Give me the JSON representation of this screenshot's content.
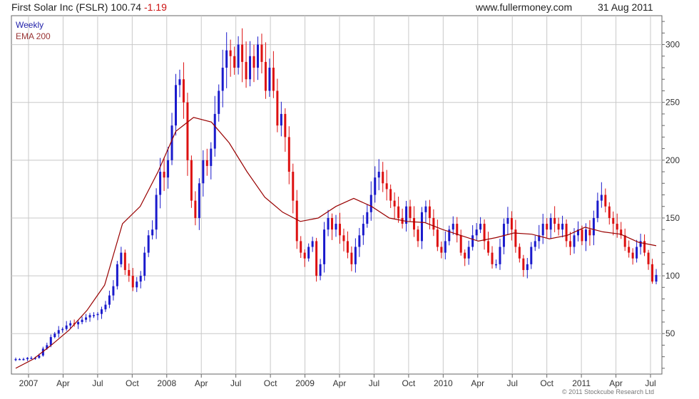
{
  "header": {
    "title_main": "First Solar Inc (FSLR) 100.74",
    "title_change": "-1.19",
    "site": "www.fullermoney.com",
    "date": "31 Aug 2011"
  },
  "legend": {
    "series1": "Weekly",
    "series2": "EMA 200"
  },
  "footer": {
    "copyright": "© 2011 Stockcube Research Ltd"
  },
  "colors": {
    "up": "#1a1acc",
    "down": "#dd1111",
    "ema": "#990000",
    "grid": "#c8c8c8"
  },
  "chart_data": {
    "type": "candlestick",
    "title": "First Solar Inc (FSLR) 100.74 -1.19",
    "ylim": [
      15,
      325
    ],
    "y_ticks": [
      50,
      100,
      150,
      200,
      250,
      300
    ],
    "x_tick_labels": [
      "2007",
      "Apr",
      "Jul",
      "Oct",
      "2008",
      "Apr",
      "Jul",
      "Oct",
      "2009",
      "Apr",
      "Jul",
      "Oct",
      "2010",
      "Apr",
      "Jul",
      "Oct",
      "2011",
      "Apr",
      "Jul"
    ],
    "series": [
      {
        "name": "Weekly",
        "kind": "close",
        "x_range": [
          "2007-01",
          "2011-08"
        ],
        "values": [
          28,
          28,
          28,
          29,
          29,
          29,
          31,
          37,
          40,
          47,
          50,
          53,
          54,
          57,
          59,
          58,
          60,
          62,
          64,
          66,
          66,
          67,
          71,
          75,
          83,
          91,
          110,
          120,
          105,
          100,
          90,
          95,
          100,
          120,
          135,
          140,
          170,
          190,
          185,
          200,
          230,
          265,
          270,
          250,
          200,
          165,
          150,
          180,
          200,
          195,
          210,
          240,
          260,
          280,
          295,
          290,
          280,
          300,
          285,
          270,
          290,
          280,
          300,
          285,
          260,
          280,
          260,
          230,
          240,
          220,
          190,
          165,
          130,
          120,
          115,
          125,
          130,
          100,
          110,
          140,
          150,
          140,
          145,
          135,
          130,
          120,
          110,
          125,
          135,
          145,
          155,
          170,
          185,
          190,
          180,
          175,
          165,
          160,
          150,
          145,
          160,
          150,
          140,
          130,
          155,
          160,
          150,
          140,
          125,
          120,
          130,
          140,
          145,
          135,
          120,
          115,
          125,
          135,
          140,
          145,
          130,
          120,
          110,
          110,
          125,
          145,
          150,
          140,
          125,
          115,
          105,
          110,
          125,
          130,
          135,
          145,
          140,
          150,
          145,
          140,
          145,
          130,
          125,
          135,
          140,
          130,
          140,
          135,
          150,
          165,
          170,
          160,
          150,
          145,
          140,
          135,
          125,
          120,
          115,
          125,
          130,
          120,
          110,
          95,
          100.74
        ]
      },
      {
        "name": "EMA 200",
        "kind": "line",
        "x_range": [
          "2007-01",
          "2011-08"
        ],
        "values": [
          20,
          28,
          40,
          53,
          70,
          92,
          145,
          160,
          190,
          225,
          237,
          233,
          215,
          190,
          168,
          155,
          147,
          150,
          160,
          167,
          160,
          150,
          147,
          146,
          140,
          135,
          130,
          133,
          137,
          136,
          132,
          135,
          142,
          138,
          136,
          129,
          126
        ]
      }
    ]
  }
}
